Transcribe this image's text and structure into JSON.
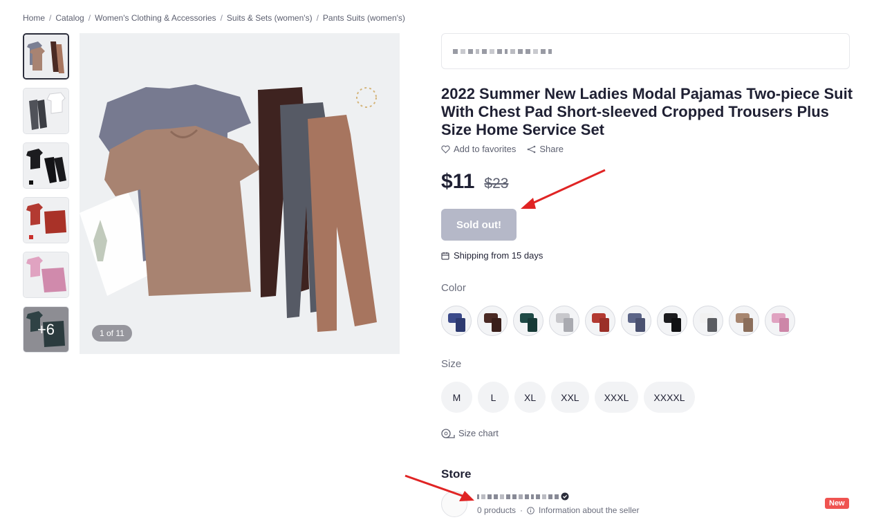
{
  "breadcrumb": [
    "Home",
    "Catalog",
    "Women's Clothing & Accessories",
    "Suits & Sets (women's)",
    "Pants Suits (women's)"
  ],
  "gallery": {
    "counter": "1 of 11",
    "more_label": "+6"
  },
  "product": {
    "title": "2022 Summer New Ladies Modal Pajamas Two-piece Suit With Chest Pad Short-sleeved Cropped Trousers Plus Size Home Service Set",
    "favorites_label": "Add to favorites",
    "share_label": "Share",
    "price_now": "$11",
    "price_old": "$23",
    "sold_out_label": "Sold out!",
    "shipping": "Shipping from 15 days"
  },
  "options": {
    "color_label": "Color",
    "colors": [
      {
        "name": "navy",
        "top": "#3b4a8a",
        "bottom": "#2d3a70"
      },
      {
        "name": "brown",
        "top": "#4a2a24",
        "bottom": "#3a1f1a"
      },
      {
        "name": "teal",
        "top": "#1f4a46",
        "bottom": "#173a37"
      },
      {
        "name": "light-gray",
        "top": "#c8c8cc",
        "bottom": "#a9aab0"
      },
      {
        "name": "red",
        "top": "#b33a32",
        "bottom": "#9b2f28"
      },
      {
        "name": "slate",
        "top": "#5c6588",
        "bottom": "#4a5170"
      },
      {
        "name": "black",
        "top": "#1c1c1f",
        "bottom": "#111113"
      },
      {
        "name": "white-gray",
        "top": "#f1f1f1",
        "bottom": "#5b5d62"
      },
      {
        "name": "mocha",
        "top": "#a78670",
        "bottom": "#8b6e5b"
      },
      {
        "name": "pink",
        "top": "#e0a3c1",
        "bottom": "#cd86a8"
      }
    ],
    "size_label": "Size",
    "sizes": [
      "M",
      "L",
      "XL",
      "XXL",
      "XXXL",
      "XXXXL"
    ],
    "size_chart_label": "Size chart"
  },
  "store": {
    "title": "Store",
    "products": "0 products",
    "info": "Information about the seller",
    "badge": "New"
  },
  "colors": {
    "accent_red": "#e02424",
    "sold_out_bg": "#b5b8c8"
  }
}
